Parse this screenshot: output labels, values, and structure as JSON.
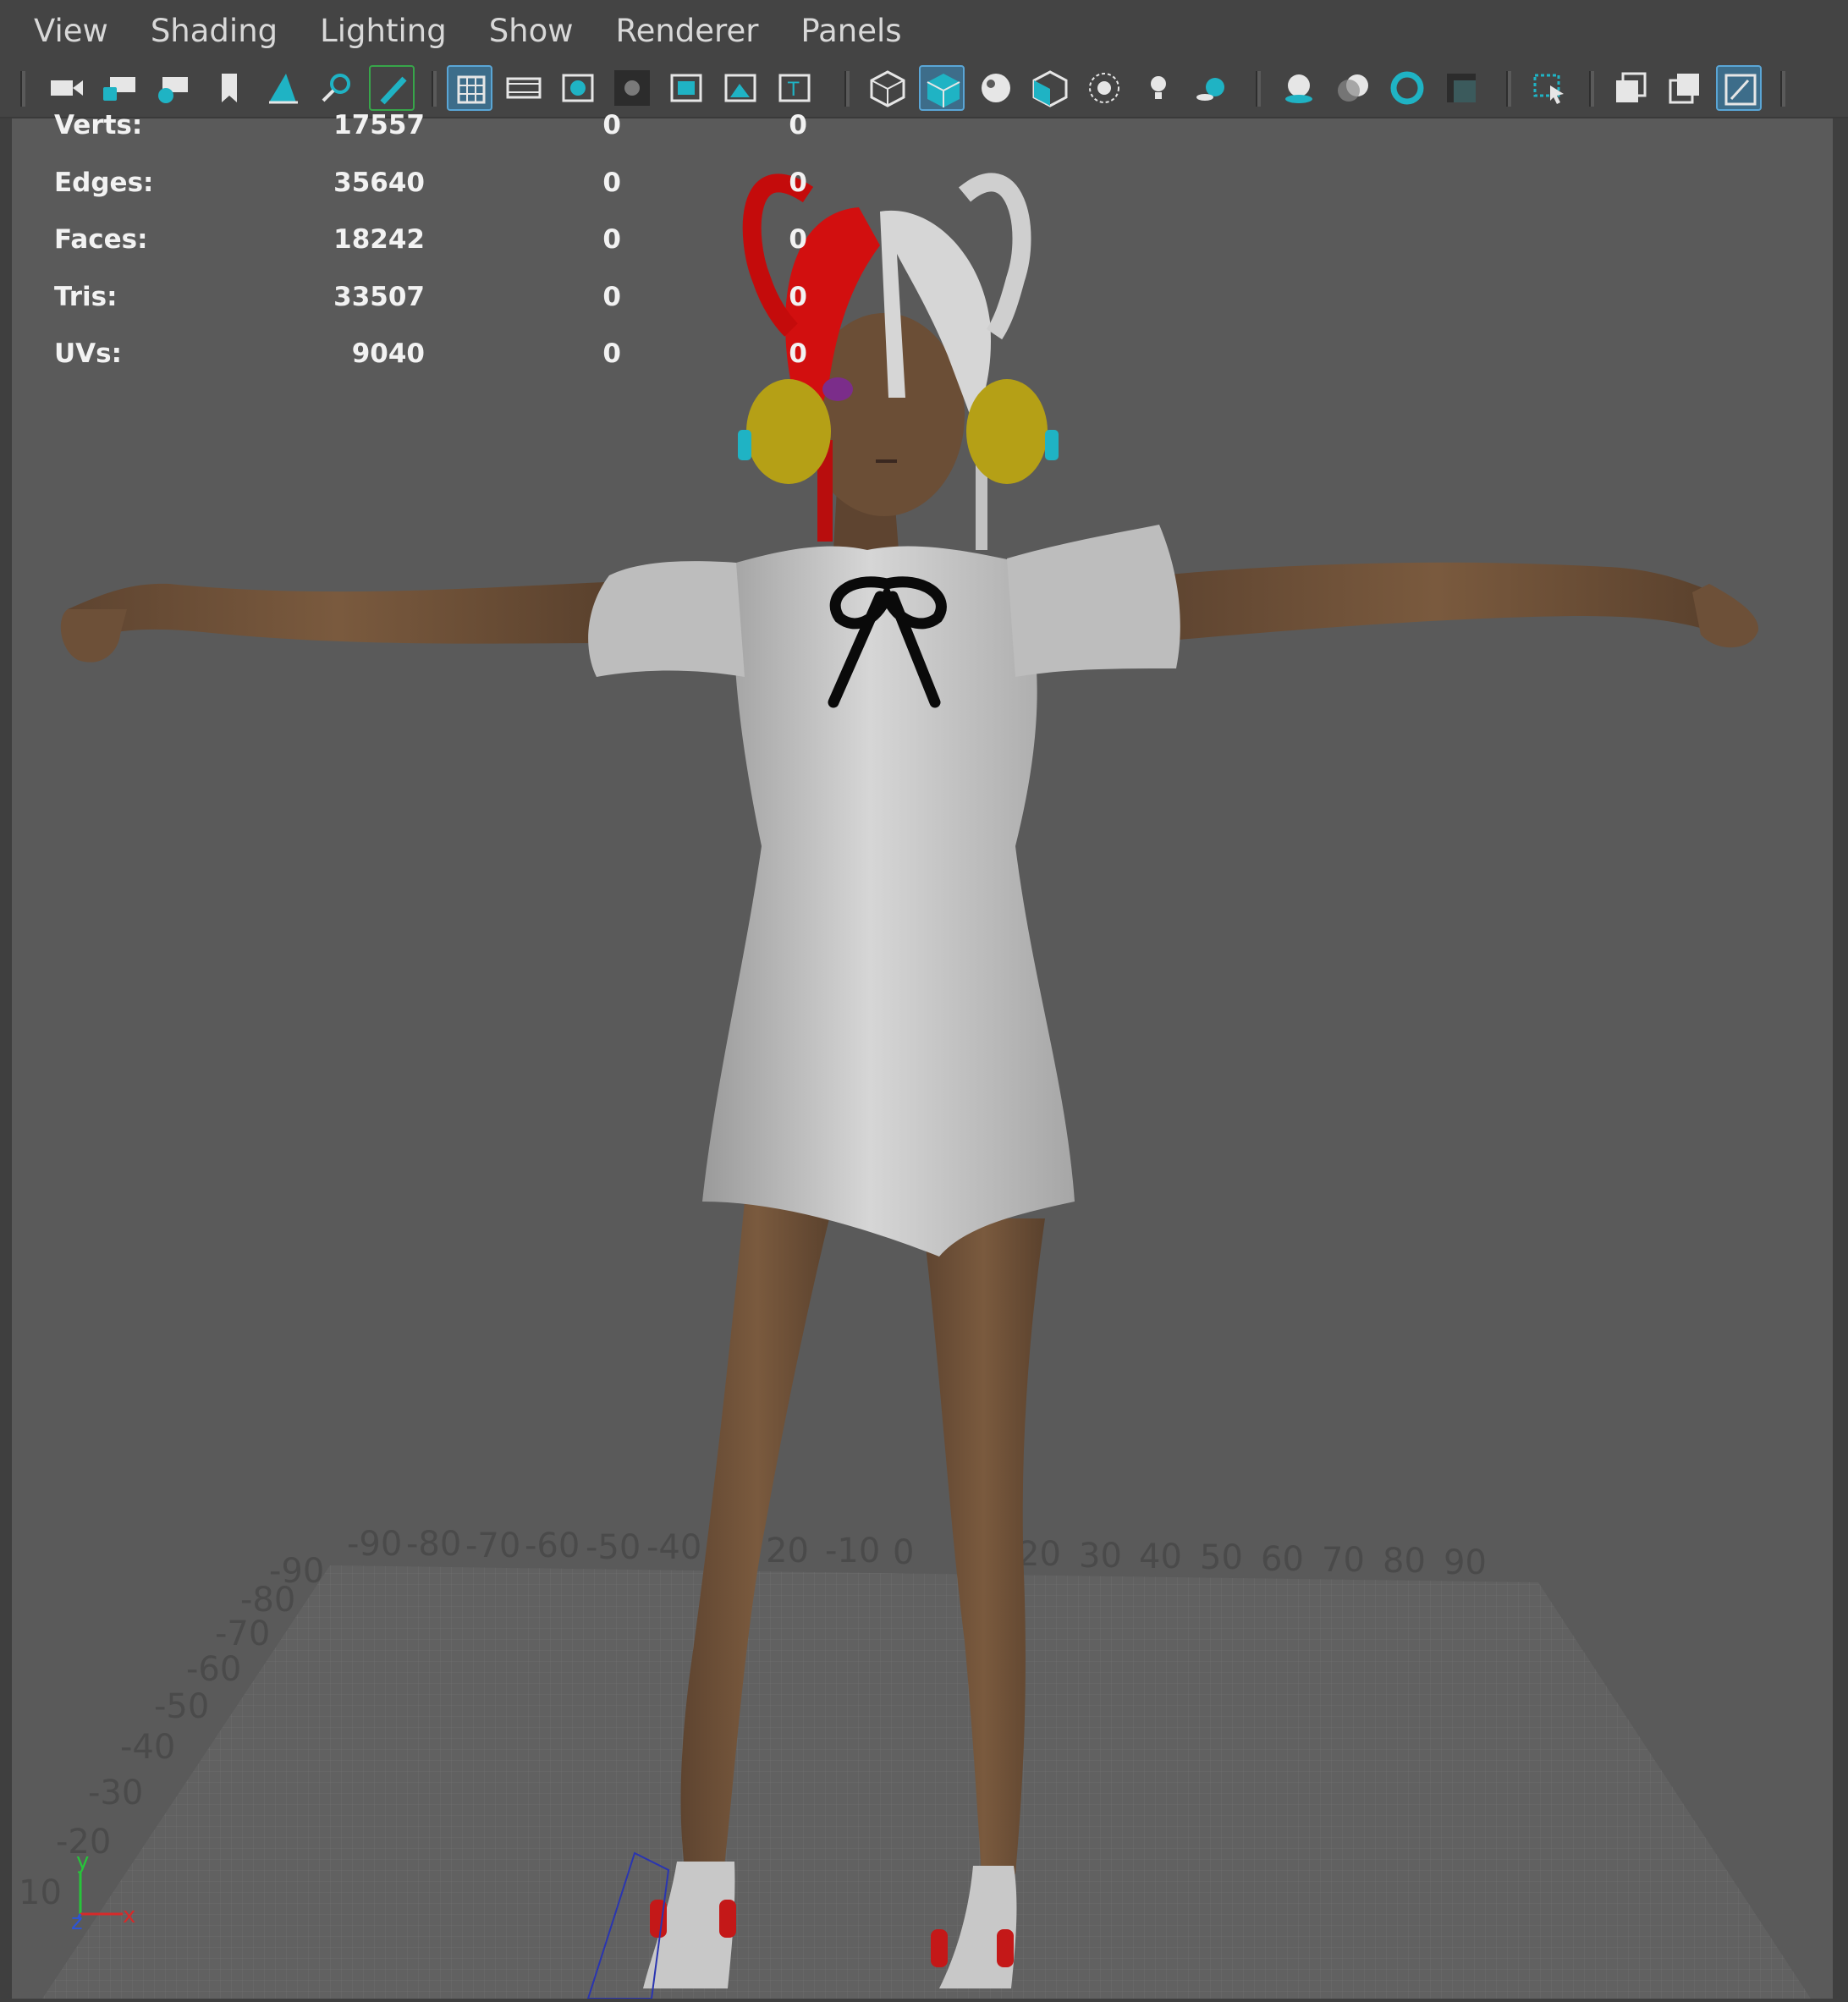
{
  "menu": {
    "items": [
      "View",
      "Shading",
      "Lighting",
      "Show",
      "Renderer",
      "Panels"
    ]
  },
  "toolbar": {
    "groups": [
      [
        "camera-icon",
        "lock-camera-icon",
        "camera-attributes-icon",
        "bookmark-icon",
        "image-plane-icon",
        "two-d-pan-zoom-icon",
        "grease-pencil-icon"
      ],
      [
        "grid-icon",
        "film-gate-icon",
        "resolution-gate-icon",
        "gate-mask-icon",
        "field-chart-icon",
        "safe-action-icon",
        "safe-title-icon"
      ],
      [
        "wireframe-icon",
        "smooth-shade-icon",
        "default-material-icon",
        "wireframe-on-shaded-icon",
        "xray-icon",
        "use-all-lights-icon",
        "shadows-icon"
      ],
      [
        "screen-space-ao-icon",
        "motion-blur-icon",
        "anti-aliasing-icon",
        "depth-of-field-icon"
      ],
      [
        "isolate-select-icon"
      ],
      [
        "xray-joints-icon",
        "xray-active-components-icon",
        "toggle-hud-icon"
      ]
    ],
    "active": [
      "grid-icon",
      "smooth-shade-icon",
      "toggle-hud-icon"
    ]
  },
  "hud": {
    "rows": [
      {
        "label": "Verts:",
        "v1": "17557",
        "v2": "0",
        "v3": "0"
      },
      {
        "label": "Edges:",
        "v1": "35640",
        "v2": "0",
        "v3": "0"
      },
      {
        "label": "Faces:",
        "v1": "18242",
        "v2": "0",
        "v3": "0"
      },
      {
        "label": "Tris:",
        "v1": "33507",
        "v2": "0",
        "v3": "0"
      },
      {
        "label": "UVs:",
        "v1": "9040",
        "v2": "0",
        "v3": "0"
      }
    ]
  },
  "grid": {
    "top_labels": [
      "-90",
      "-80",
      "-70",
      "-60",
      "-50",
      "-40",
      "20",
      "-10",
      "0",
      "20",
      "30",
      "40",
      "50",
      "60",
      "70",
      "80",
      "90"
    ],
    "side_labels": [
      "-90",
      "-80",
      "-70",
      "-60",
      "-50",
      "-40",
      "-30",
      "-20",
      "10"
    ]
  },
  "axis_gizmo": {
    "y": "y",
    "x": "x",
    "z": "z"
  },
  "colors": {
    "background": "#5a5a5a",
    "toolbar": "#444444",
    "accent": "#1fb3c4",
    "hair_red": "#d60f0f",
    "hair_white": "#d4d4d4",
    "skin": "#6b4e34",
    "dress": "#c9c9c9",
    "headphones": "#b8a314"
  }
}
